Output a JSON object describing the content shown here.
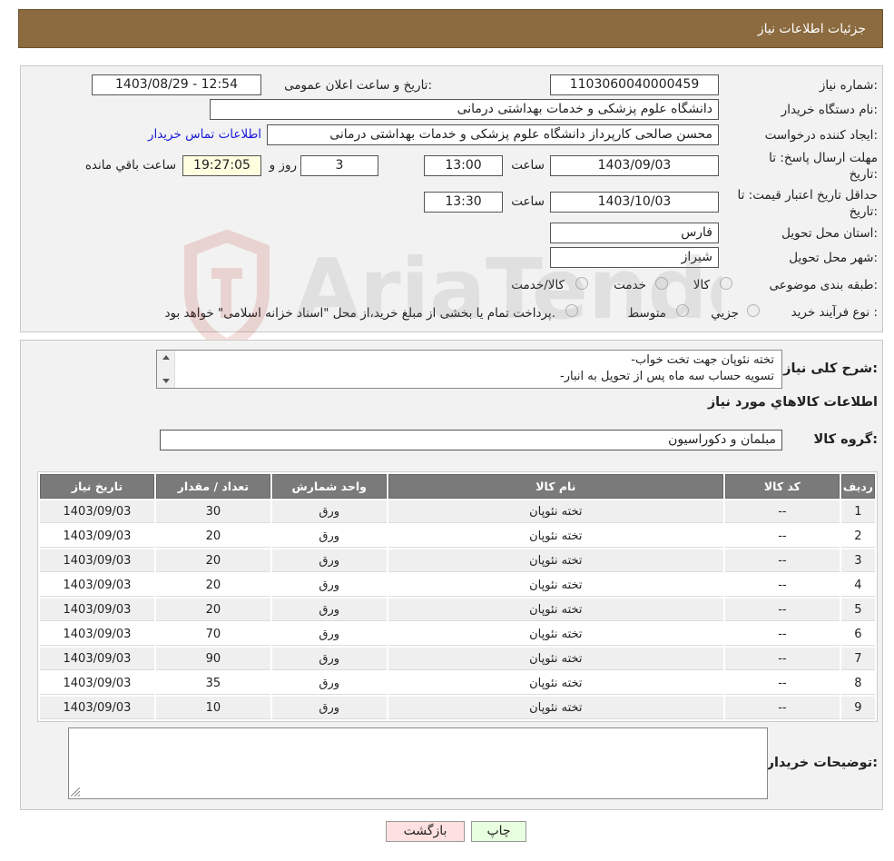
{
  "header": {
    "title": "جزئیات اطلاعات نیاز"
  },
  "form": {
    "need_number_label": "شماره نیاز:",
    "need_number": "1103060040000459",
    "announce_label": "تاریخ و ساعت اعلان عمومی:",
    "announce_value": "1403/08/29 - 12:54",
    "buyer_org_label": "نام دستگاه خریدار:",
    "buyer_org": "دانشگاه علوم پزشکی و خدمات بهداشتی درمانی",
    "requester_label": "ایجاد کننده درخواست:",
    "requester": "محسن صالحی کارپرداز دانشگاه علوم پزشکی و خدمات بهداشتی درمانی",
    "contact_link": "اطلاعات تماس خریدار",
    "deadline_label_1": "مهلت ارسال پاسخ: تا",
    "deadline_label_2": "تاریخ:",
    "deadline_date": "1403/09/03",
    "time_label": "ساعت",
    "deadline_time": "13:00",
    "days_value": "3",
    "days_label": "روز و",
    "remaining_time": "19:27:05",
    "remaining_label": "ساعت باقي مانده",
    "validity_label_1": "حداقل تاريخ اعتبار قيمت: تا",
    "validity_label_2": "تاريخ:",
    "validity_date": "1403/10/03",
    "validity_time_label": "ساعت",
    "validity_time": "13:30",
    "province_label": "استان محل تحویل:",
    "province": "فارس",
    "city_label": "شهر محل تحویل:",
    "city": "شیراز",
    "category_label": "طبقه بندی موضوعی:",
    "category_options": [
      "کالا",
      "خدمت",
      "کالا/خدمت"
    ],
    "purchase_type_label": "نوع فرآیند خرید :",
    "purchase_options": [
      "جزيي",
      "متوسط"
    ],
    "purchase_note": "پرداخت تمام یا بخشی از مبلغ خرید،از محل \"اسناد خزانه اسلامی\" خواهد بود."
  },
  "description": {
    "label": "شرح کلی نیاز:",
    "lines": [
      "-تخته نئوپان جهت تخت خواب",
      "-تسویه حساب سه ماه پس از تحویل به انبار"
    ]
  },
  "goods": {
    "section_title": "اطلاعات کالاهاي مورد نياز",
    "group_label": "گروه کالا:",
    "group_value": "مبلمان و دکوراسیون",
    "columns": [
      "ردیف",
      "کد کالا",
      "نام کالا",
      "واحد شمارش",
      "تعداد / مقدار",
      "تاریخ نیاز"
    ],
    "rows": [
      [
        "1",
        "--",
        "تخته نئوپان",
        "ورق",
        "30",
        "1403/09/03"
      ],
      [
        "2",
        "--",
        "تخته نئوپان",
        "ورق",
        "20",
        "1403/09/03"
      ],
      [
        "3",
        "--",
        "تخته نئوپان",
        "ورق",
        "20",
        "1403/09/03"
      ],
      [
        "4",
        "--",
        "تخته نئوپان",
        "ورق",
        "20",
        "1403/09/03"
      ],
      [
        "5",
        "--",
        "تخته نئوپان",
        "ورق",
        "20",
        "1403/09/03"
      ],
      [
        "6",
        "--",
        "تخته نئوپان",
        "ورق",
        "70",
        "1403/09/03"
      ],
      [
        "7",
        "--",
        "تخته نئوپان",
        "ورق",
        "90",
        "1403/09/03"
      ],
      [
        "8",
        "--",
        "تخته نئوپان",
        "ورق",
        "35",
        "1403/09/03"
      ],
      [
        "9",
        "--",
        "تخته نئوپان",
        "ورق",
        "10",
        "1403/09/03"
      ]
    ]
  },
  "buyer_notes": {
    "label": "توضیحات خریدار:",
    "value": ""
  },
  "buttons": {
    "print": "چاپ",
    "back": "بازگشت"
  },
  "colors": {
    "header_bg": "#8b6b3f",
    "table_header_bg": "#7a7a7a",
    "back_button_bg": "#ffe0e0",
    "print_button_bg": "#e8ffe0"
  }
}
